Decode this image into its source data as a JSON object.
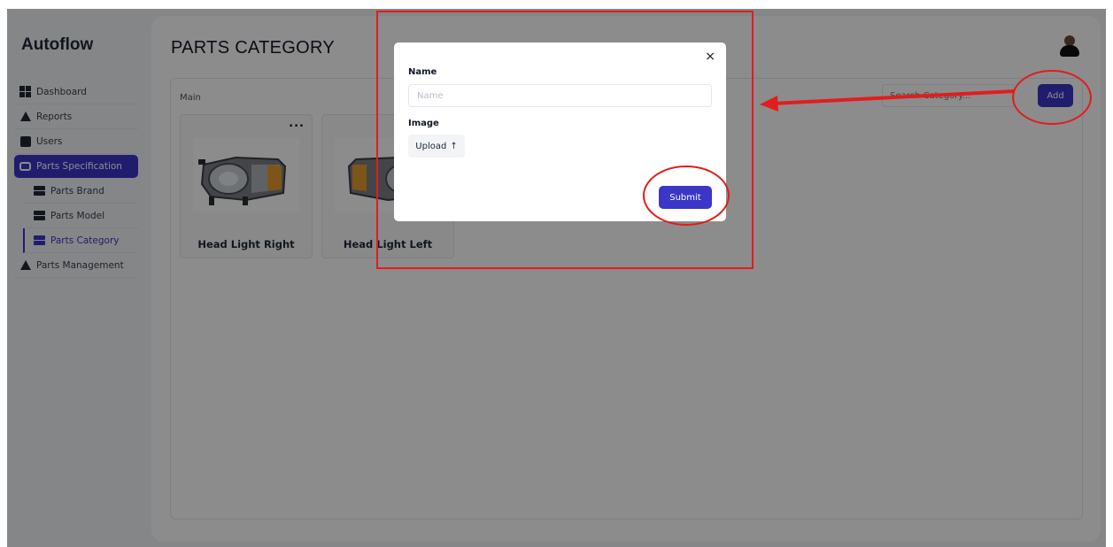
{
  "app": {
    "brand": "Autoflow"
  },
  "sidebar": {
    "items": [
      {
        "label": "Dashboard",
        "icon": "dashboard-icon"
      },
      {
        "label": "Reports",
        "icon": "reports-icon"
      },
      {
        "label": "Users",
        "icon": "users-icon"
      },
      {
        "label": "Parts Specification",
        "icon": "car-icon"
      },
      {
        "label": "Parts Brand",
        "icon": "list-icon"
      },
      {
        "label": "Parts Model",
        "icon": "list-icon"
      },
      {
        "label": "Parts Category",
        "icon": "list-icon"
      },
      {
        "label": "Parts Management",
        "icon": "management-icon"
      }
    ]
  },
  "header": {
    "title": "PARTS CATEGORY"
  },
  "content": {
    "breadcrumb": "Main",
    "search_placeholder": "Search Category...",
    "add_label": "Add",
    "cards": [
      {
        "name": "Head Light Right",
        "menu": "..."
      },
      {
        "name": "Head Light Left"
      }
    ]
  },
  "modal": {
    "name_label": "Name",
    "name_placeholder": "Name",
    "name_value": "",
    "image_label": "Image",
    "upload_label": "Upload",
    "upload_icon": "↑",
    "close_label": "×",
    "submit_label": "Submit"
  },
  "colors": {
    "accent": "#3b36c8",
    "annotation": "#e11d1d",
    "overlay": "rgba(0,0,0,0.45)"
  }
}
